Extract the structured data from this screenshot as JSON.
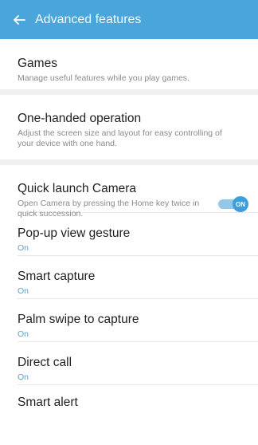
{
  "header": {
    "title": "Advanced features",
    "back_icon": "arrow-left-icon",
    "color": "#4aa6da"
  },
  "items": [
    {
      "title": "Games",
      "description": "Manage useful features while you play games."
    },
    {
      "title": "One-handed operation",
      "description": "Adjust the screen size and layout for easy controlling of your device with one hand."
    },
    {
      "title": "Quick launch Camera",
      "description": "Open Camera by pressing the Home key twice in quick succession.",
      "toggle": "ON",
      "toggle_on": true
    },
    {
      "title": "Pop-up view gesture",
      "status": "On"
    },
    {
      "title": "Smart capture",
      "status": "On"
    },
    {
      "title": "Palm swipe to capture",
      "status": "On"
    },
    {
      "title": "Direct call",
      "status": "On"
    },
    {
      "title": "Smart alert"
    }
  ],
  "accent_color": "#4aa6da"
}
